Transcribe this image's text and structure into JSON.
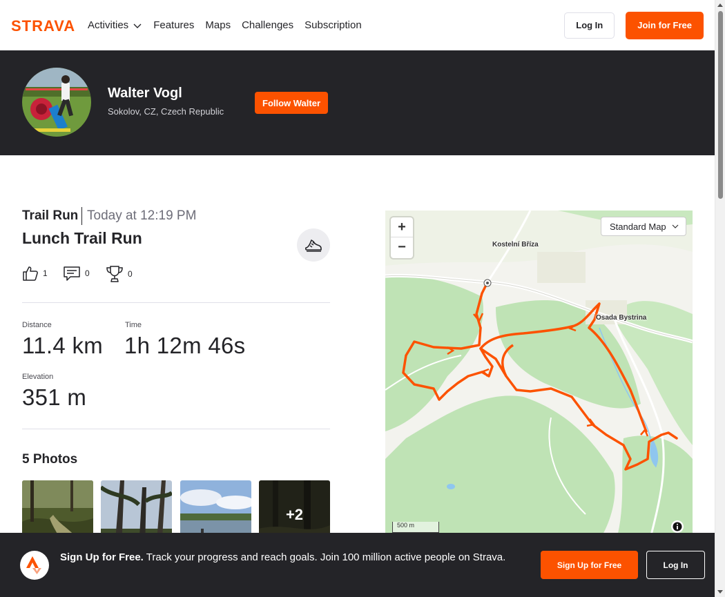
{
  "header": {
    "logo_text": "STRAVA",
    "nav": [
      {
        "label": "Activities",
        "has_dropdown": true
      },
      {
        "label": "Features"
      },
      {
        "label": "Maps"
      },
      {
        "label": "Challenges"
      },
      {
        "label": "Subscription"
      }
    ],
    "login_label": "Log In",
    "join_label": "Join for Free"
  },
  "athlete": {
    "name": "Walter Vogl",
    "location": "Sokolov, CZ, Czech Republic",
    "follow_label": "Follow Walter"
  },
  "activity": {
    "type": "Trail Run",
    "time": "Today at 12:19 PM",
    "title": "Lunch Trail Run",
    "sport_icon": "running-shoe-icon",
    "kudos_count": "1",
    "comment_count": "0",
    "achievement_count": "0",
    "stats": {
      "distance_label": "Distance",
      "distance_value": "11.4 km",
      "time_label": "Time",
      "time_value": "1h 12m 46s",
      "elevation_label": "Elevation",
      "elevation_value": "351 m"
    }
  },
  "photos": {
    "title": "5 Photos",
    "more_label": "+2"
  },
  "map": {
    "zoom_in": "+",
    "zoom_out": "−",
    "style_label": "Standard Map",
    "scale_label": "500 m",
    "places": [
      "Kostelní Bříza",
      "Osada Bystrina"
    ],
    "route_color": "#fc5200"
  },
  "signup": {
    "headline": "Sign Up for Free.",
    "body": "Track your progress and reach goals. Join 100 million active people on Strava.",
    "button_label": "Sign Up for Free",
    "login_label": "Log In"
  },
  "colors": {
    "brand": "#fc5200",
    "dark": "#242428"
  }
}
